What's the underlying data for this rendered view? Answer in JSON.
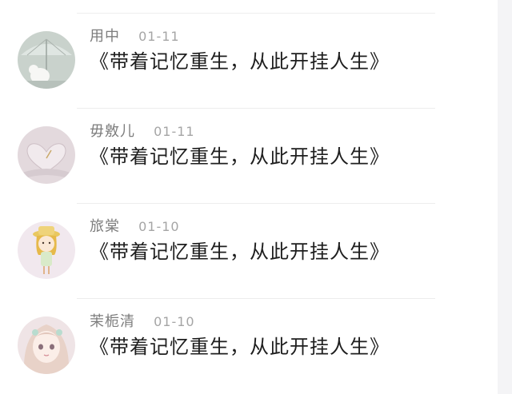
{
  "comments": [
    {
      "username": "用中",
      "date": "01-11",
      "text": "《带着记忆重生，从此开挂人生》",
      "avatar_icon": "umbrella-bird-avatar"
    },
    {
      "username": "毋敫儿",
      "date": "01-11",
      "text": "《带着记忆重生，从此开挂人生》",
      "avatar_icon": "heart-book-avatar"
    },
    {
      "username": "旅棠",
      "date": "01-10",
      "text": "《带着记忆重生，从此开挂人生》",
      "avatar_icon": "cartoon-girl-avatar"
    },
    {
      "username": "茉栀清",
      "date": "01-10",
      "text": "《带着记忆重生，从此开挂人生》",
      "avatar_icon": "anime-girl-avatar"
    }
  ]
}
